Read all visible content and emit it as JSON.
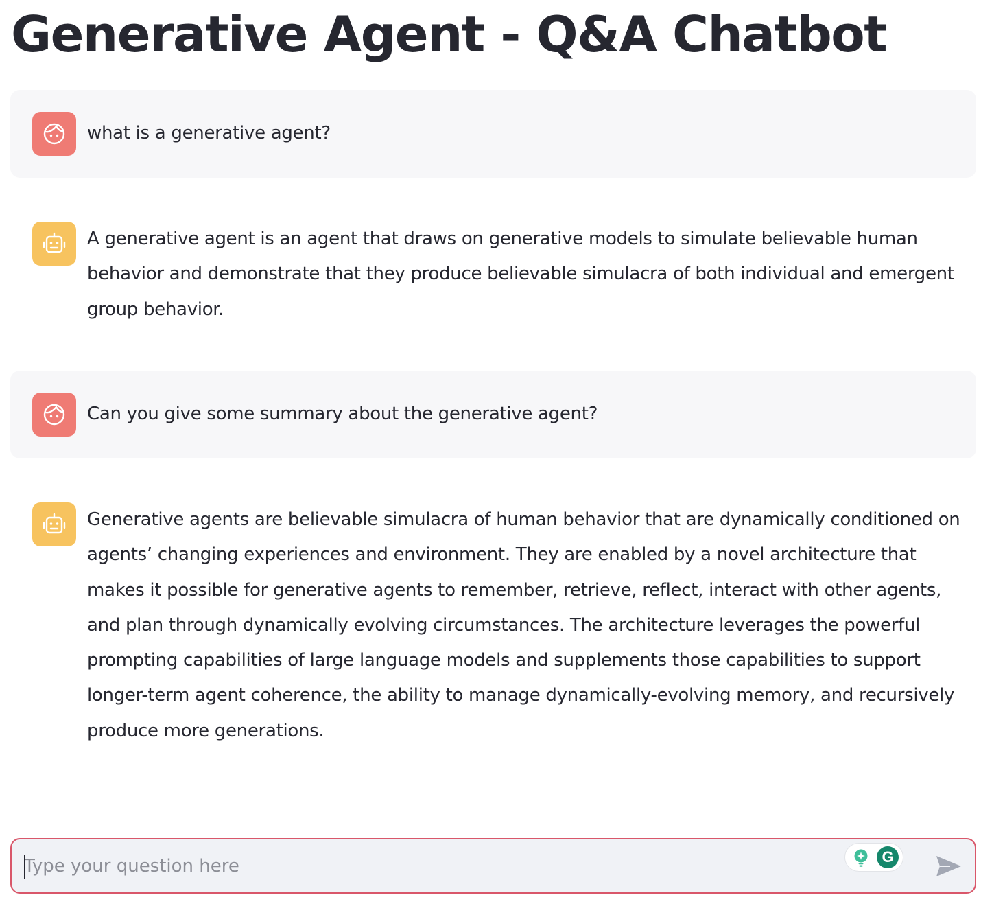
{
  "page": {
    "title": "Generative Agent - Q&A Chatbot"
  },
  "messages": [
    {
      "role": "user",
      "text": "what is a generative agent?"
    },
    {
      "role": "assistant",
      "text": "A generative agent is an agent that draws on generative models to simulate believable human behavior and demonstrate that they produce believable simulacra of both individual and emergent group behavior."
    },
    {
      "role": "user",
      "text": "Can you give some summary about the generative agent?"
    },
    {
      "role": "assistant",
      "text": "Generative agents are believable simulacra of human behavior that are dynamically conditioned on agents’ changing experiences and environment. They are enabled by a novel architecture that makes it possible for generative agents to remember, retrieve, reflect, interact with other agents, and plan through dynamically evolving circumstances. The architecture leverages the powerful prompting capabilities of large language models and supplements those capabilities to support longer-term agent coherence, the ability to manage dynamically-evolving memory, and recursively produce more generations."
    }
  ],
  "input": {
    "placeholder": "Type your question here",
    "value": ""
  },
  "icons": {
    "user_avatar": "user-face-icon",
    "assistant_avatar": "robot-icon",
    "grammarly_suggestion": "lightbulb-icon",
    "grammarly_logo": "grammarly-icon",
    "send": "send-arrow-icon"
  },
  "grammarly": {
    "badge_letter": "G"
  },
  "colors": {
    "user_avatar_bg": "#ef7b74",
    "assistant_avatar_bg": "#f7c35f",
    "user_message_bg": "#f7f7f9",
    "input_border": "#d9576a",
    "input_bg": "#f0f2f6",
    "grammarly_green": "#15876b",
    "text": "#262730"
  }
}
